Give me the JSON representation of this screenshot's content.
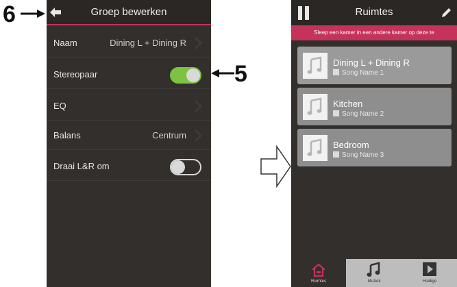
{
  "callouts": {
    "six": "6",
    "five": "5"
  },
  "left_screen": {
    "title": "Groep bewerken",
    "rows": [
      {
        "label": "Naam",
        "value": "Dining L + Dining R"
      },
      {
        "label": "Stereopaar",
        "toggle": "on"
      },
      {
        "label": "EQ"
      },
      {
        "label": "Balans",
        "value": "Centrum"
      },
      {
        "label": "Draai L&R om",
        "toggle": "off"
      }
    ]
  },
  "right_screen": {
    "title": "Ruimtes",
    "instruction": "Sleep een kamer in een andere kamer op deze te",
    "rooms": [
      {
        "name": "Dining L + Dining R",
        "song": "Song Name 1"
      },
      {
        "name": "Kitchen",
        "song": "Song Name 2"
      },
      {
        "name": "Bedroom",
        "song": "Song Name 3"
      }
    ],
    "tabs": [
      {
        "label": "Ruimtes",
        "icon": "home-icon"
      },
      {
        "label": "Muziek",
        "icon": "music-note-icon"
      },
      {
        "label": "Huidige",
        "icon": "play-icon"
      }
    ]
  },
  "colors": {
    "accent": "#c5325a",
    "toggle_on": "#7dc243",
    "background": "#322f2c"
  }
}
